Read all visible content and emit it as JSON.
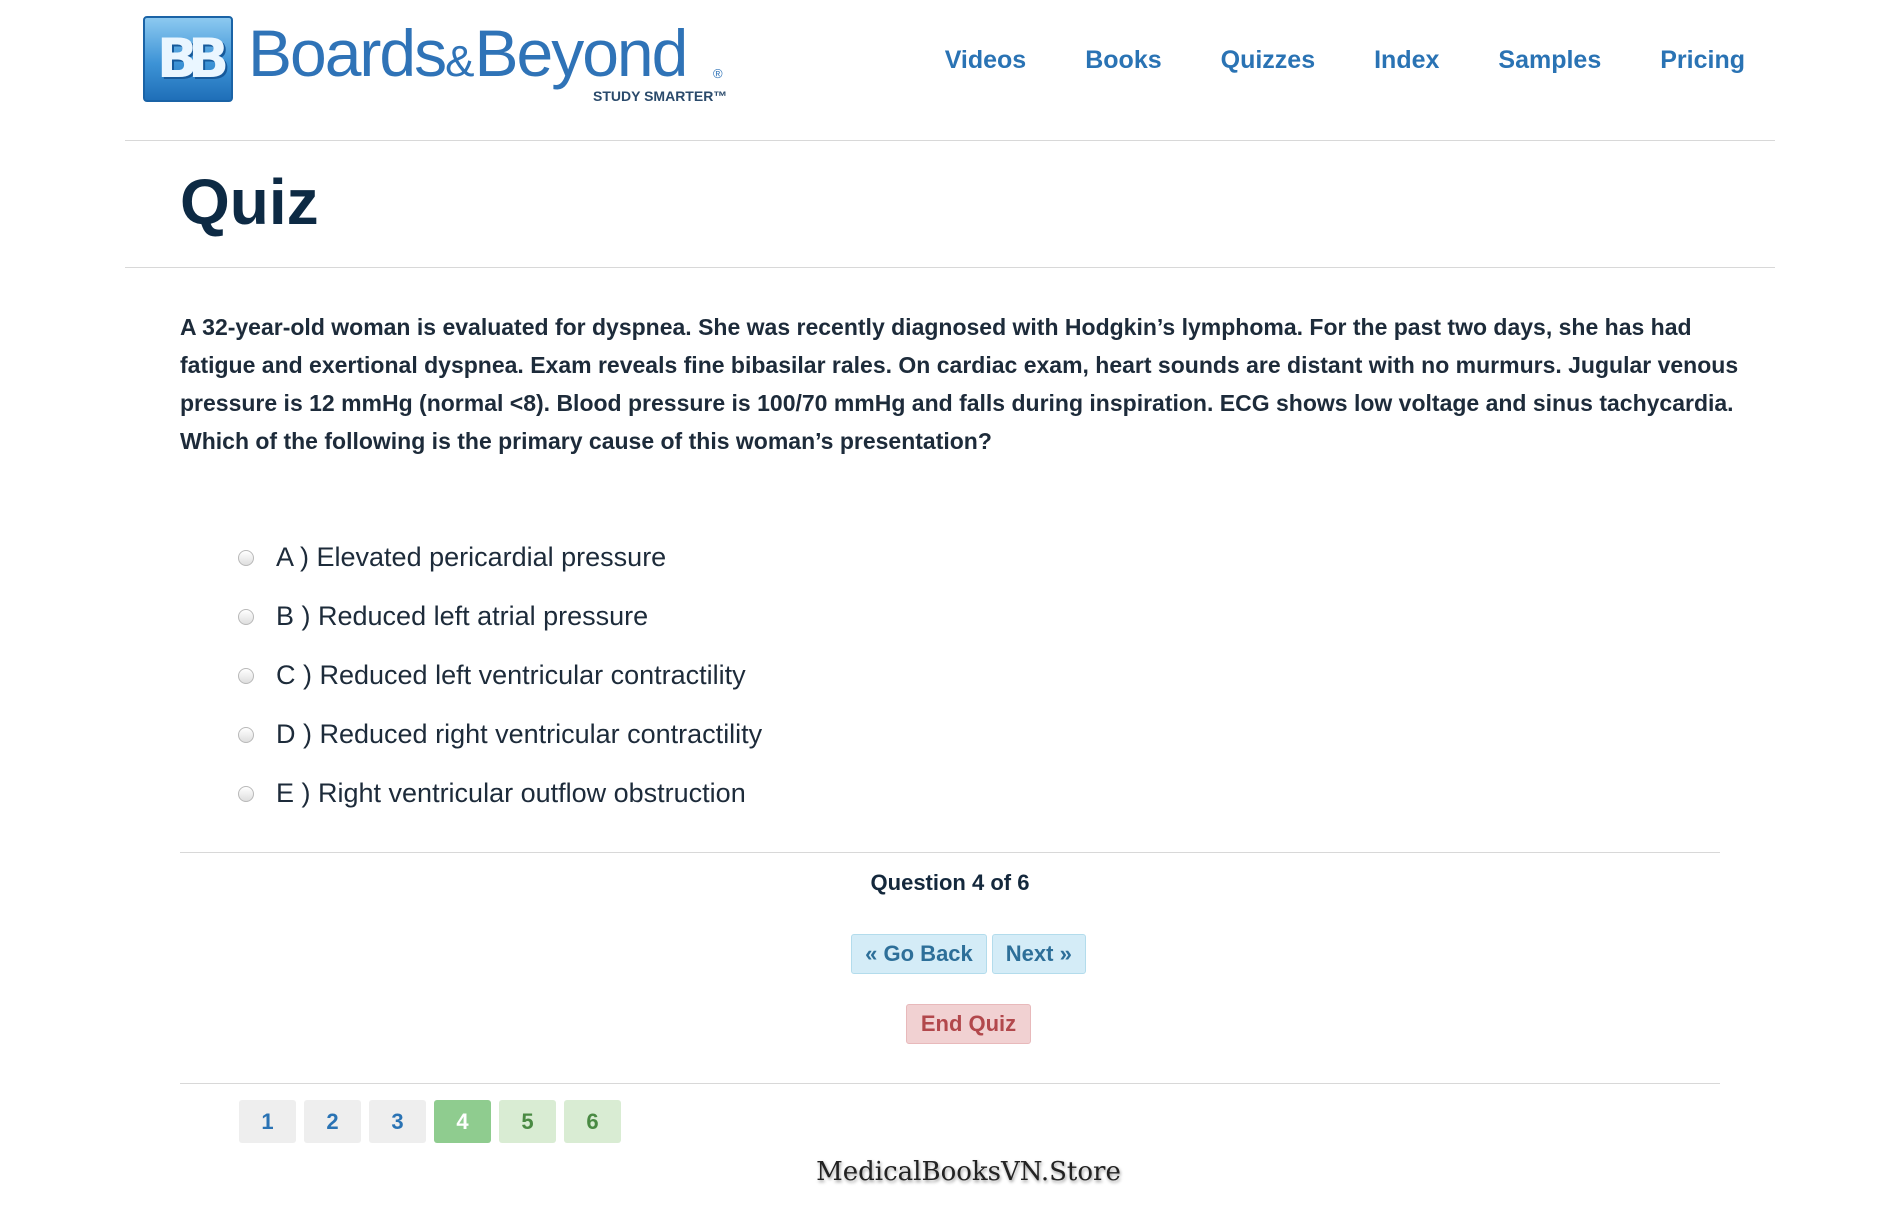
{
  "brand": {
    "mark": "BB",
    "name_first": "Boards",
    "name_amp": "&",
    "name_second": "Beyond",
    "registered": "®",
    "tagline": "STUDY SMARTER™"
  },
  "nav": {
    "items": [
      "Videos",
      "Books",
      "Quizzes",
      "Index",
      "Samples",
      "Pricing"
    ]
  },
  "page": {
    "title": "Quiz"
  },
  "question": {
    "text": "A 32-year-old woman is evaluated for dyspnea. She was recently diagnosed with Hodgkin’s lymphoma. For the past two days, she has had fatigue and exertional dyspnea. Exam reveals fine bibasilar rales. On cardiac exam, heart sounds are distant with no murmurs. Jugular venous pressure is 12 mmHg (normal <8). Blood pressure is 100/70 mmHg and falls during inspiration. ECG shows low voltage and sinus tachycardia. Which of the following is the primary cause of this woman’s presentation?",
    "answers": [
      "A ) Elevated pericardial pressure",
      "B ) Reduced left atrial pressure",
      "C ) Reduced left ventricular contractility",
      "D ) Reduced right ventricular contractility",
      "E ) Right ventricular outflow obstruction"
    ]
  },
  "progress": {
    "label": "Question 4 of 6",
    "current": 4,
    "total": 6
  },
  "buttons": {
    "back": "« Go Back",
    "next": "Next »",
    "end": "End Quiz"
  },
  "pagination": {
    "pages": [
      "1",
      "2",
      "3",
      "4",
      "5",
      "6"
    ]
  },
  "watermark": "MedicalBooksVN.Store",
  "colors": {
    "brand_blue": "#2a73b4",
    "title_navy": "#0d2a44",
    "info_bg": "#d4ecf7",
    "danger_bg": "#f1d1d2",
    "danger_text": "#b2484c",
    "page_current": "#8fcc8f",
    "page_upcoming": "#d9ecd3"
  }
}
